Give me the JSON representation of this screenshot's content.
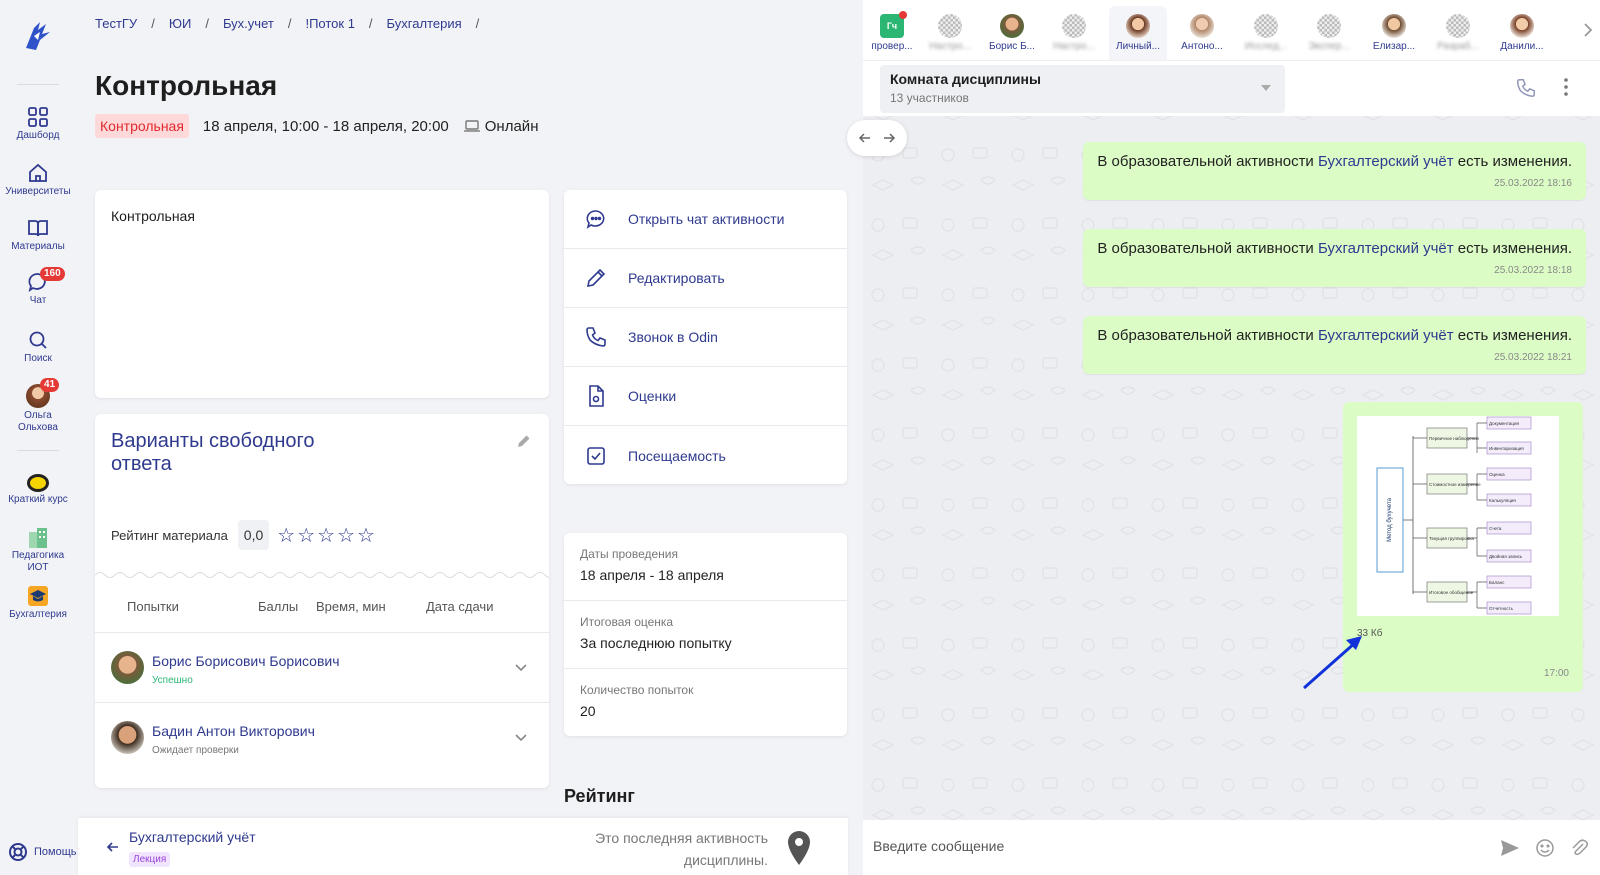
{
  "breadcrumbs": [
    "ТестГУ",
    "ЮИ",
    "Бух.учет",
    "!Поток 1",
    "Бухгалтерия"
  ],
  "page": {
    "title": "Контрольная",
    "type_tag": "Контрольная",
    "dates": "18 апреля, 10:00 - 18 апреля, 20:00",
    "mode": "Онлайн",
    "description": "Контрольная"
  },
  "sidebar": {
    "items": [
      {
        "label": "Дашборд",
        "icon": "grid-icon"
      },
      {
        "label": "Университеты",
        "icon": "home-icon"
      },
      {
        "label": "Материалы",
        "icon": "book-icon"
      },
      {
        "label": "Чат",
        "icon": "chat-icon",
        "badge": "160"
      },
      {
        "label": "Поиск",
        "icon": "search-icon"
      },
      {
        "label": "Ольга Ольхова",
        "icon": "avatar",
        "badge": "41"
      }
    ],
    "courses": [
      {
        "label": "Краткий курс"
      },
      {
        "label": "Педагогика ИОТ"
      },
      {
        "label": "Бухгалтерия"
      }
    ],
    "help": "Помощь"
  },
  "actions": [
    {
      "label": "Открыть чат активности",
      "icon": "chat-bubble-icon"
    },
    {
      "label": "Редактировать",
      "icon": "pencil-icon"
    },
    {
      "label": "Звонок в Odin",
      "icon": "phone-icon"
    },
    {
      "label": "Оценки",
      "icon": "document-icon"
    },
    {
      "label": "Посещаемость",
      "icon": "checkbox-icon"
    }
  ],
  "variants": {
    "title": "Варианты свободного ответа",
    "rating_label": "Рейтинг материала",
    "rating_value": "0,0",
    "stars": 0,
    "columns": [
      "Попытки",
      "Баллы",
      "Время, мин",
      "Дата сдачи"
    ],
    "rows": [
      {
        "name": "Борис Борисович Борисович",
        "status": "Успешно",
        "status_color": "#2bb673"
      },
      {
        "name": "Бадин Антон Викторович",
        "status": "Ожидает проверки",
        "status_color": "#777777"
      }
    ]
  },
  "info": [
    {
      "label": "Даты проведения",
      "value": "18 апреля - 18 апреля"
    },
    {
      "label": "Итоговая оценка",
      "value": "За последнюю попытку"
    },
    {
      "label": "Количество попыток",
      "value": "20"
    }
  ],
  "rating_heading": "Рейтинг",
  "footer": {
    "name": "Бухгалтерский учёт",
    "tag": "Лекция",
    "last_text": "Это последняя активность дисциплины."
  },
  "chat": {
    "contacts": [
      {
        "label": "провер...",
        "kind": "group",
        "initials": "Гч"
      },
      {
        "label": "Настро...",
        "kind": "blurred"
      },
      {
        "label": "Борис Б...",
        "kind": "avatar"
      },
      {
        "label": "Настро...",
        "kind": "blurred"
      },
      {
        "label": "Личный...",
        "kind": "avatar"
      },
      {
        "label": "Антоно...",
        "kind": "avatar"
      },
      {
        "label": "Исслед...",
        "kind": "blurred"
      },
      {
        "label": "Экспер...",
        "kind": "blurred"
      },
      {
        "label": "Елизар...",
        "kind": "avatar"
      },
      {
        "label": "Разраб...",
        "kind": "blurred"
      },
      {
        "label": "Данили...",
        "kind": "avatar"
      }
    ],
    "room": {
      "name": "Комната дисциплины",
      "count": "13 участников"
    },
    "messages": [
      {
        "pre": "В образовательной активности ",
        "link": "Бухгалтерский учёт",
        "post": " есть изменения.",
        "time": "25.03.2022 18:16"
      },
      {
        "pre": "В образовательной активности ",
        "link": "Бухгалтерский учёт",
        "post": " есть изменения.",
        "time": "25.03.2022 18:18"
      },
      {
        "pre": "В образовательной активности ",
        "link": "Бухгалтерский учёт",
        "post": " есть изменения.",
        "time": "25.03.2022 18:21"
      }
    ],
    "image_message": {
      "size": "33 Кб",
      "time": "17:00",
      "diagram": {
        "root": "Метод бухучета",
        "groups": [
          {
            "label": "Первичное наблюдение",
            "leaves": [
              "Документация",
              "Инвентаризация"
            ]
          },
          {
            "label": "Стоимостное измерение",
            "leaves": [
              "Оценка",
              "Калькуляция"
            ]
          },
          {
            "label": "Текущая группировка",
            "leaves": [
              "Счета",
              "Двойная запись"
            ]
          },
          {
            "label": "Итоговое обобщение",
            "leaves": [
              "Баланс",
              "Отчетность"
            ]
          }
        ]
      }
    },
    "input_placeholder": "Введите сообщение"
  },
  "colors": {
    "accent": "#2f3a8f",
    "bubble": "#dcfcc6",
    "danger": "#e53935"
  }
}
